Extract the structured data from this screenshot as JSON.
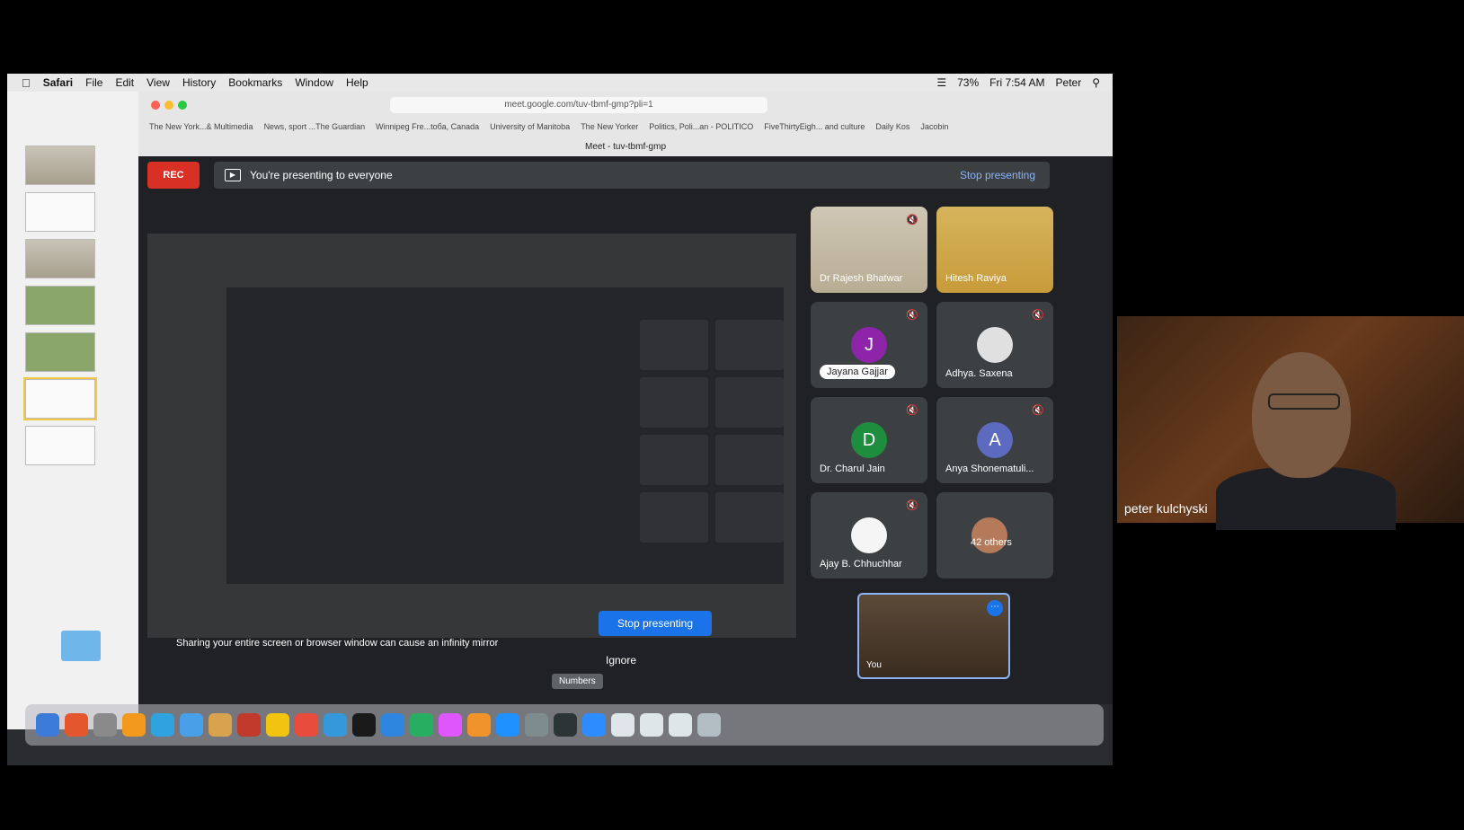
{
  "menubar": {
    "app": "Safari",
    "items": [
      "File",
      "Edit",
      "View",
      "History",
      "Bookmarks",
      "Window",
      "Help"
    ],
    "battery": "73%",
    "clock": "Fri 7:54 AM",
    "user": "Peter"
  },
  "browser": {
    "url": "meet.google.com/tuv-tbmf-gmp?pli=1",
    "bookmarks": [
      "The New York...& Multimedia",
      "News, sport ...The Guardian",
      "Winnipeg Fre...tоба, Canada",
      "University of Manitoba",
      "The New Yorker",
      "Politics, Poli...an - POLITICO",
      "FiveThirtyEigh... and culture",
      "Daily Kos",
      "Jacobin"
    ],
    "tab_title": "Meet - tuv-tbmf-gmp"
  },
  "meet": {
    "rec_label": "REC",
    "presenting_text": "You're presenting to everyone",
    "stop_presenting_link": "Stop presenting",
    "stop_presenting_button": "Stop presenting",
    "warning": "Sharing your entire screen or browser window can cause an infinity mirror",
    "ignore": "Ignore",
    "tooltip": "Numbers",
    "participants": [
      {
        "name": "Dr Rajesh Bhatwar",
        "kind": "video"
      },
      {
        "name": "Hitesh Raviya",
        "kind": "video2"
      },
      {
        "name": "Jayana Gajjar",
        "initial": "J",
        "color": "#8e24aa"
      },
      {
        "name": "Adhya. Saxena",
        "kind": "photo"
      },
      {
        "name": "Dr. Charul Jain",
        "initial": "D",
        "color": "#1e8e3e"
      },
      {
        "name": "Anya Shonematuli...",
        "initial": "A",
        "color": "#5c6bc0"
      },
      {
        "name": "Ajay B. Chhuchhar",
        "kind": "photo"
      },
      {
        "name": "42 others",
        "kind": "others"
      }
    ],
    "self_label": "You"
  },
  "webcam": {
    "name": "peter kulchyski"
  },
  "colors": {
    "rec_red": "#d93025",
    "meet_blue": "#1a73e8",
    "meet_bg": "#202124"
  }
}
